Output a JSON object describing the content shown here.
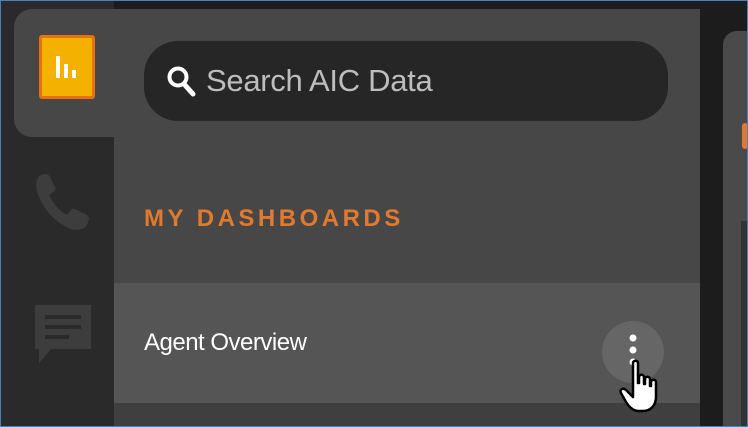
{
  "rail": {
    "items": [
      {
        "icon": "bar-chart-icon",
        "active": true
      },
      {
        "icon": "phone-icon",
        "active": false
      },
      {
        "icon": "chat-icon",
        "active": false
      }
    ]
  },
  "search": {
    "placeholder": "Search AIC Data",
    "icon": "search-icon"
  },
  "dashboards": {
    "title": "MY DASHBOARDS",
    "items": [
      {
        "label": "Agent Overview",
        "menu_icon": "more-vertical-icon"
      }
    ]
  },
  "colors": {
    "accent": "#e07a2e",
    "logo_fill": "#f5b100",
    "panel": "#474747",
    "rail": "#2a2a2a"
  }
}
